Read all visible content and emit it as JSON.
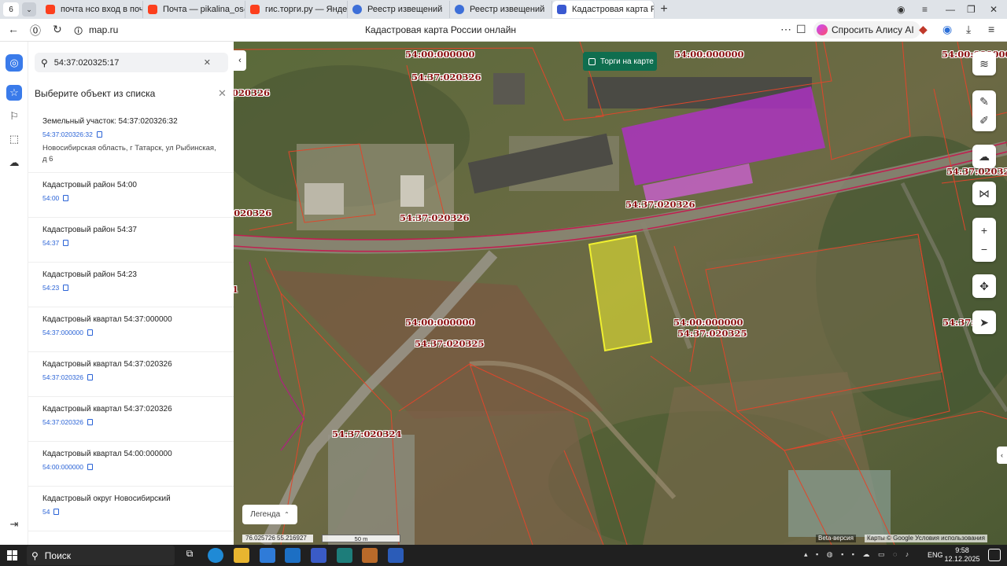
{
  "browser": {
    "tab_count": "6",
    "tabs": [
      {
        "label": "почта нсо вход в почту —",
        "icon": "yandex-icon",
        "color": "#fc3f1d"
      },
      {
        "label": "Почта — pikalina_os@nso",
        "icon": "mail-icon",
        "color": "#fc3f1d"
      },
      {
        "label": "гис.торги.ру — Яндекс: н",
        "icon": "yandex-icon",
        "color": "#fc3f1d"
      },
      {
        "label": "Реестр извещений",
        "icon": "gear-icon",
        "color": "#3d6fd8"
      },
      {
        "label": "Реестр извещений",
        "icon": "gear-icon",
        "color": "#3d6fd8"
      },
      {
        "label": "Кадастровая карта Росс",
        "icon": "map-icon",
        "color": "#3a59d1"
      }
    ],
    "url": "map.ru",
    "page_title": "Кадастровая карта России онлайн",
    "alice_label": "Спросить Алису AI"
  },
  "sidebar": {
    "search_value": "54:37:020325:17",
    "header": "Выберите объект из списка",
    "items": [
      {
        "title": "Земельный участок: 54:37:020326:32",
        "code": "54:37:020326:32",
        "address": "Новосибирская область, г Татарск, ул Рыбинская, д 6"
      },
      {
        "title": "Кадастровый район 54:00",
        "code": "54:00"
      },
      {
        "title": "Кадастровый район 54:37",
        "code": "54:37"
      },
      {
        "title": "Кадастровый район 54:23",
        "code": "54:23"
      },
      {
        "title": "Кадастровый квартал 54:37:000000",
        "code": "54:37:000000"
      },
      {
        "title": "Кадастровый квартал 54:37:020326",
        "code": "54:37:020326"
      },
      {
        "title": "Кадастровый квартал 54:37:020326",
        "code": "54:37:020326"
      },
      {
        "title": "Кадастровый квартал 54:00:000000",
        "code": "54:00:000000"
      },
      {
        "title": "Кадастровый округ Новосибирский",
        "code": "54"
      }
    ]
  },
  "map": {
    "torgi_label": "Торги на карте",
    "legend_label": "Легенда",
    "coords": "76.025726  55.216927",
    "scale": "50 m",
    "beta": "Beta-версия",
    "attribution": "Карты © Google   Условия использования",
    "labels": [
      "54:00:000000",
      "54:00:000000",
      "54:00:000000",
      "54:37:020326",
      "020326",
      "54:37:020326",
      "54:37:020326",
      ":020326",
      "54:37:020326",
      "54:37:02032",
      "54:00:000000",
      "54:37:020325",
      "54:00:000000",
      "54:37:020325",
      "54:37:0",
      "54:37:020324",
      "1"
    ]
  },
  "taskbar": {
    "search_label": "Поиск",
    "lang": "ENG",
    "time": "9:58",
    "date": "12.12.2025"
  },
  "colors": {
    "parcel_outline": "#e0462b",
    "highlight": "#f0f030",
    "building_fill": "#b030c8",
    "torgi_bg": "#0f6e4f",
    "link": "#2a63d6"
  }
}
